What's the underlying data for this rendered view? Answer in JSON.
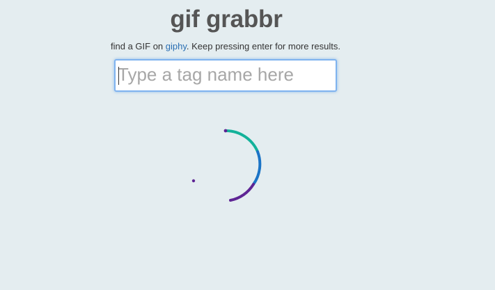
{
  "app": {
    "title": "gif grabbr"
  },
  "subtitle": {
    "prefix": "find a GIF on ",
    "link": "giphy",
    "suffix": ". Keep pressing enter for more results."
  },
  "search": {
    "value": "",
    "placeholder": "Type a tag name here"
  },
  "loader": {
    "icon": "loading-spinner-icon",
    "colors": {
      "teal": "#13b29a",
      "blue": "#1b74c6",
      "purple": "#5e2594"
    }
  }
}
